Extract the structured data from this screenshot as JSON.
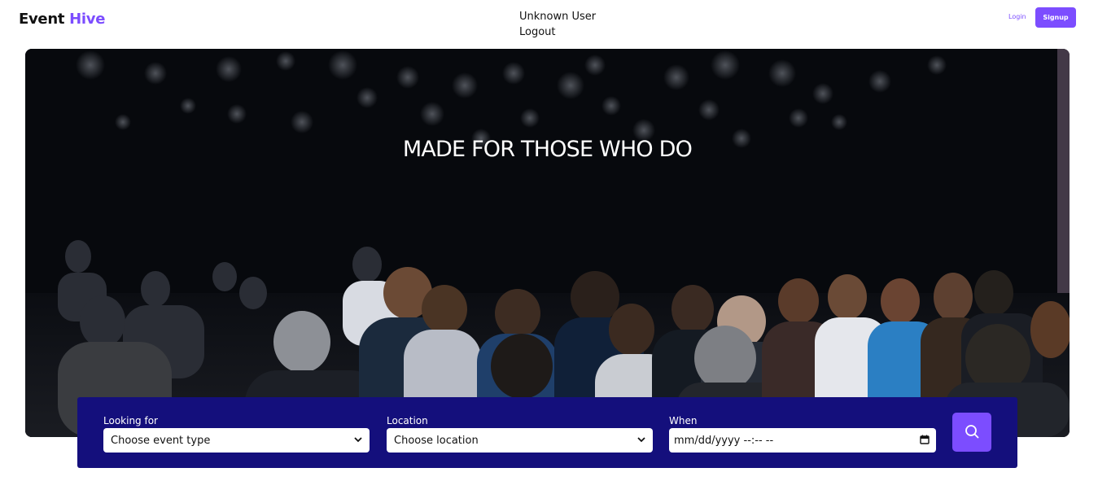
{
  "header": {
    "brand": {
      "part1": "Event",
      "part2": "Hive"
    },
    "user_name": "Unknown User",
    "logout_label": "Logout",
    "login_label": "Login",
    "signup_label": "Signup"
  },
  "hero": {
    "title": "MADE FOR THOSE WHO DO",
    "image": "conference audience photo"
  },
  "search": {
    "looking_for": {
      "label": "Looking for",
      "value": "Choose event type"
    },
    "location": {
      "label": "Location",
      "value": "Choose location"
    },
    "when": {
      "label": "When",
      "value": "mm/dd/yyyy --:-- --"
    },
    "search_icon": "search-icon"
  },
  "colors": {
    "accent": "#7c4dff",
    "panel": "#140f7c",
    "hero_bg": "#07090d"
  }
}
